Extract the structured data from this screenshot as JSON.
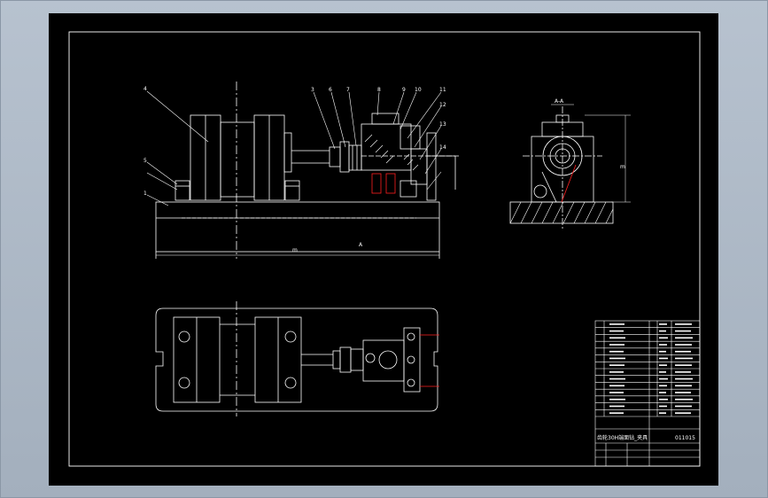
{
  "drawing": {
    "background_color": "#000000",
    "line_color": "#ffffff",
    "accent_color": "#ff2020",
    "viewport_color": "#b8c3d0",
    "balloons": [
      "4",
      "5",
      "1",
      "3",
      "6",
      "7",
      "8",
      "9",
      "10",
      "11",
      "12",
      "13",
      "14"
    ],
    "overall_length_label": "ⅿ",
    "section_label": "A-A",
    "view_marker": "A",
    "height_label": "ⅿ"
  },
  "title_block": {
    "title": "齿轮30H端面钻_夹具",
    "code": "011015",
    "parts_rows": 14
  }
}
